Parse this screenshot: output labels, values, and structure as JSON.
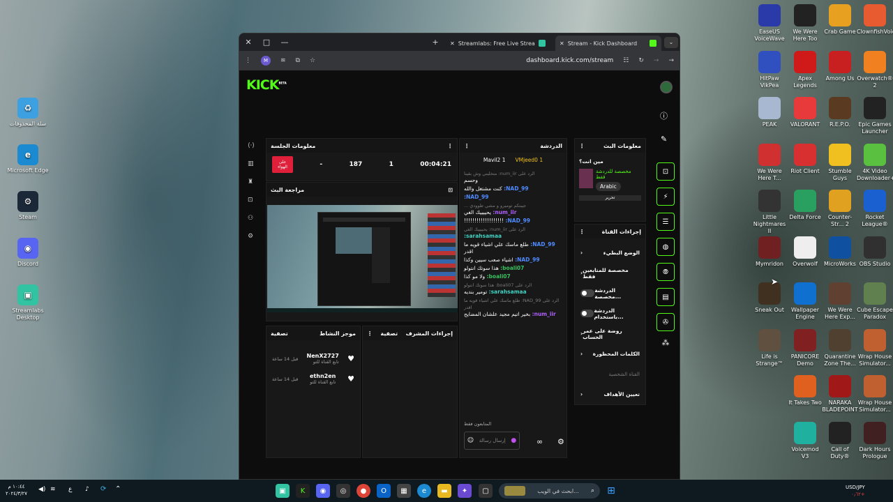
{
  "desktop_left": [
    {
      "label": "سلة المحذوفات",
      "icon": "recycle-bin-icon",
      "color": "#3da0e0",
      "glyph": "♻"
    },
    {
      "label": "Microsoft Edge",
      "icon": "edge-icon",
      "color": "#1b8ad0",
      "glyph": "e"
    },
    {
      "label": "Steam",
      "icon": "steam-icon",
      "color": "#1b2838",
      "glyph": "⚙"
    },
    {
      "label": "Discord",
      "icon": "discord-icon",
      "color": "#5865f2",
      "glyph": "◉"
    },
    {
      "label": "Streamlabs Desktop",
      "icon": "streamlabs-icon",
      "color": "#31c3a2",
      "glyph": "▣"
    }
  ],
  "desktop_right": [
    [
      "EaseUS VoiceWave",
      "We Were Here Too",
      "Crab Game",
      "ClownfishVoice"
    ],
    [
      "HitPaw VikPea",
      "Apex Legends",
      "Among Us",
      "Overwatch® 2"
    ],
    [
      "PEAK",
      "VALORANT",
      "R.E.P.O.",
      "Epic Games Launcher"
    ],
    [
      "We Were Here T...",
      "Riot Client",
      "Stumble Guys",
      "4K Video Downloader+"
    ],
    [
      "Little Nightmares II",
      "Delta Force",
      "Counter-Str... 2",
      "Rocket League®"
    ],
    [
      "Mymridon",
      "Overwolf",
      "MicroWorks",
      "OBS Studio"
    ],
    [
      "Sneak Out",
      "Wallpaper Engine",
      "We Were Here Exp...",
      "Cube Escape Paradox"
    ],
    [
      "Life is Strange™",
      "PANICORE Demo",
      "Quarantine Zone The...",
      "Wrap House Simulator..."
    ],
    [
      "",
      "It Takes Two",
      "NARAKA BLADEPOINT",
      "Wrap House Simulator..."
    ],
    [
      "",
      "Voicemod V3",
      "Call of Duty®",
      "Dark Hours Prologue"
    ]
  ],
  "desktop_right_colors": [
    [
      "#2a3aa8",
      "#222",
      "#e8a020",
      "#e85a30"
    ],
    [
      "#3050c0",
      "#d01a1a",
      "#c82020",
      "#f08020"
    ],
    [
      "#a8b8d0",
      "#e83a3a",
      "#5a3a20",
      "#222"
    ],
    [
      "#d03030",
      "#d83030",
      "#f0c020",
      "#5ac040"
    ],
    [
      "#333",
      "#2aa060",
      "#e0a020",
      "#1a60d0"
    ],
    [
      "#702020",
      "#eee",
      "#1050a0",
      "#303030"
    ],
    [
      "#403020",
      "#1070d0",
      "#604030",
      "#608050"
    ],
    [
      "#605040",
      "#802020",
      "#504030",
      "#c06030"
    ],
    [
      "",
      "#e06020",
      "#a01818",
      "#c06030"
    ],
    [
      "",
      "#20b0a0",
      "#222",
      "#402020"
    ]
  ],
  "browser": {
    "tabs": [
      {
        "label": "Streamlabs: Free Live Streaming"
      },
      {
        "label": "Stream - Kick Dashboard"
      }
    ],
    "url": "dashboard.kick.com/stream",
    "profile": "M"
  },
  "kick": {
    "logo": "KICK",
    "logo_sup": "BETA",
    "session": {
      "title": "معلومات الجلسة",
      "live_badge": "على الهواء",
      "stats": [
        "-",
        "187",
        "1",
        "00:04:21"
      ]
    },
    "review": {
      "title": "مراجعة البث"
    },
    "chat": {
      "title": "الدردشة",
      "pinned": [
        {
          "name": "VMjeed0",
          "count": "1"
        },
        {
          "name": "Mavil2",
          "count": "1"
        }
      ],
      "messages": [
        {
          "reply": "الرد على num_iir: متخليني وش بقينا",
          "user": "",
          "text": "وحسم",
          "color": "#fff"
        },
        {
          "reply": "",
          "user": "NAD_99:",
          "text": "كنت مشتغل والله",
          "color": "#4f8bff"
        },
        {
          "reply": "",
          "user": "NAD_99:",
          "text": "",
          "color": "#4f8bff"
        },
        {
          "reply": "جيبتكم توميرو و مشي طوودي ...",
          "user": "num_iir:",
          "text": "يحييييك الغي",
          "color": "#b060ff"
        },
        {
          "reply": "",
          "user": "NAD_99:",
          "text": "!!!!!!!!!!!!!!!!!!!",
          "color": "#4f8bff"
        },
        {
          "reply": "الرد على num_iir: يحييييك الغي",
          "user": "sarahsamaa:",
          "text": "",
          "color": "#3fd0c0"
        },
        {
          "reply": "",
          "user": "NAD_99:",
          "text": "طلع ماسك علي اشياء قويه ما اقدر",
          "color": "#4f8bff"
        },
        {
          "reply": "",
          "user": "NAD_99:",
          "text": "اشياء صعب سيين وكذا",
          "color": "#4f8bff"
        },
        {
          "reply": "",
          "user": "boali07:",
          "text": "هذا سوتك انتولو",
          "color": "#39c060"
        },
        {
          "reply": "",
          "user": "boali07:",
          "text": "ولا مو كذا",
          "color": "#39c060"
        },
        {
          "reply": "الرد على boali07: هذا سوتك انتولو",
          "user": "sarahsamaa:",
          "text": "تومير بنديه",
          "color": "#3fd0c0"
        },
        {
          "reply": "الرد على NAD_99: طلع ماسك علي اشياء قويه ما اقدر",
          "user": "num_iir:",
          "text": "بخير اتيم مجيد علشان المضايح",
          "color": "#b060ff"
        }
      ],
      "followers_only": "المتابعون فقط",
      "input_placeholder": "إرسال رسالة"
    },
    "stream_info": {
      "title": "معلومات البث",
      "who": "مين انت؟",
      "tag": "مخصصة للدردشة فقط",
      "lang": "Arabic",
      "edit": "تحرير"
    },
    "channel_actions": {
      "title": "إجراءات القناة",
      "items": [
        {
          "label": "الوضع البطيء",
          "type": "arrow"
        },
        {
          "label": "مخصصة للمتابعين فقط",
          "type": "arrow"
        },
        {
          "label": "الدردشة مخصصة...",
          "type": "toggle"
        },
        {
          "label": "الدردشة باستخدام...",
          "type": "toggle"
        },
        {
          "label": "روضة على عمر الحساب",
          "type": "arrow"
        },
        {
          "label": "الكلمات المحظورة",
          "type": "arrow"
        },
        {
          "label": "القناة الشخصية",
          "type": "none"
        },
        {
          "label": "تعيين الأهداف",
          "type": "arrow"
        }
      ]
    },
    "activity": {
      "title": "موجز النشاط",
      "filter": "تصفية",
      "items": [
        {
          "name": "NenX2727",
          "sub": "تابع القناة للتو",
          "time": "قبل 14 ساعة"
        },
        {
          "name": "ethn2en",
          "sub": "تابع القناة للتو",
          "time": "قبل 14 ساعة"
        }
      ]
    },
    "mod_actions": {
      "title": "إجراءات المشرف",
      "filter": "تصفية"
    }
  },
  "taskbar": {
    "search_placeholder": "ابحث في الويب...",
    "clock_time": "١٠:٤٤ م",
    "clock_date": "٢٠٢٤/٣/٢٧",
    "currency": "USD/JPY",
    "currency_val": "٠٫٦٢+",
    "lang": "ع"
  }
}
